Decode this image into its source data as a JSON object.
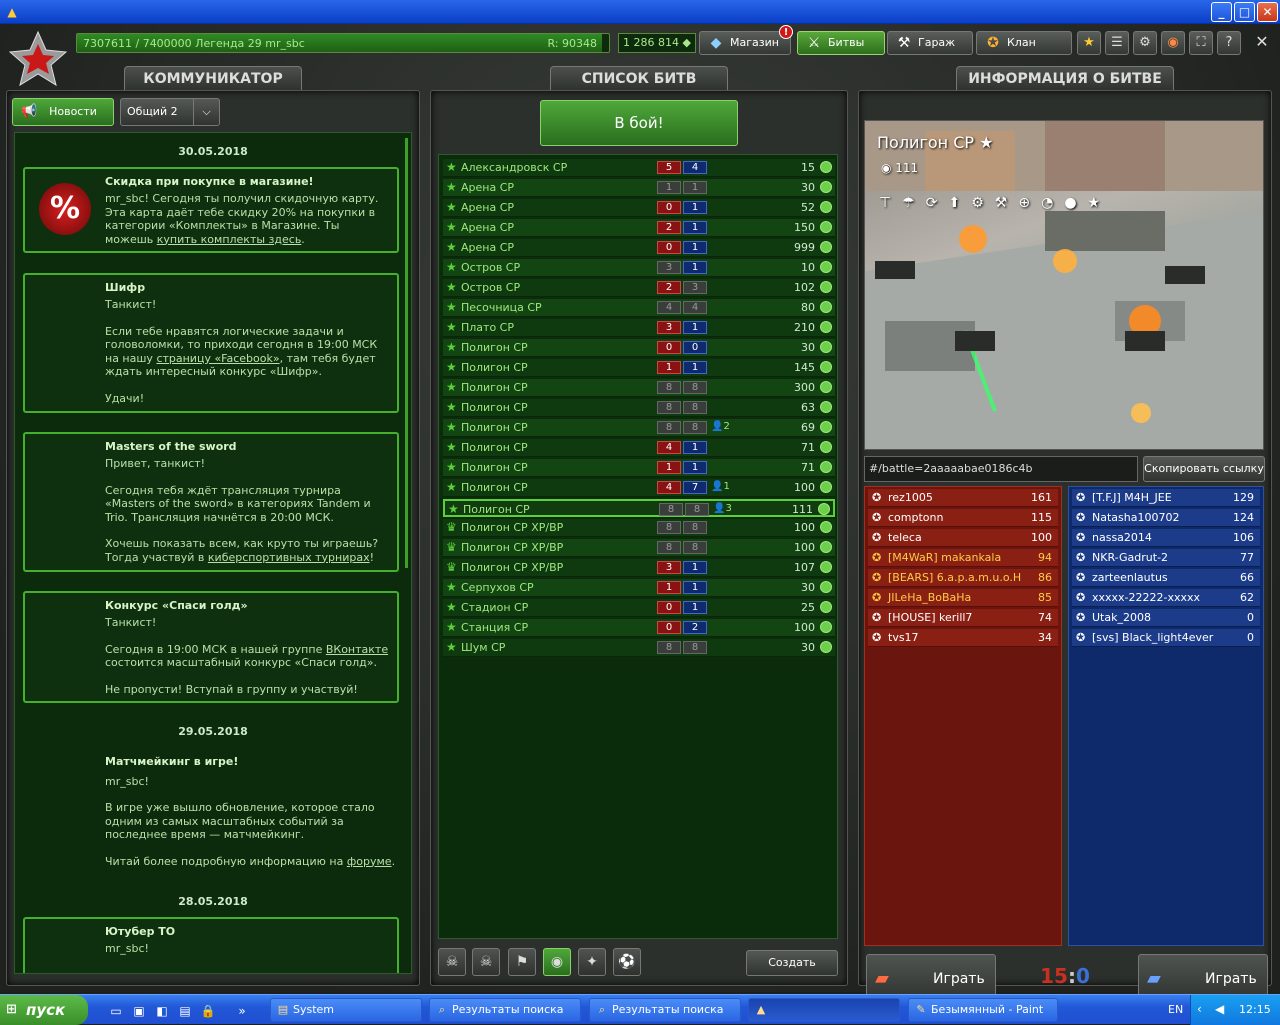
{
  "window": {
    "min": "_",
    "max": "□",
    "close": "✕"
  },
  "topbar": {
    "xp_text": "7307611 / 7400000  Легенда 29 mr_sbc",
    "rating": "R: 90348",
    "xp_progress": 0.987,
    "crystals": "1 286 814 ◆",
    "notification_badge": "!",
    "buttons": {
      "shop": "Магазин",
      "battles": "Битвы",
      "garage": "Гараж",
      "clan": "Клан"
    }
  },
  "communicator": {
    "title": "КОММУНИКАТОР",
    "news_tab": "Новости",
    "channel_select": "Общий 2",
    "days": [
      {
        "date": "30.05.2018"
      },
      {
        "date": "29.05.2018"
      },
      {
        "date": "28.05.2018"
      }
    ],
    "cards": [
      {
        "title": "Скидка при покупке в магазине!",
        "p1_a": "mr_sbc! Сегодня ты получил скидочную карту. Эта карта даёт тебе скидку 20% на покупки в категории «Комплекты» в Магазине. Ты можешь ",
        "p1_link": "купить комплекты здесь",
        "p1_b": "."
      },
      {
        "title": "Шифр",
        "p1": "Танкист!",
        "p2_a": "Если тебе нравятся логические задачи и головоломки, то приходи сегодня в 19:00 МСК на нашу ",
        "p2_link": "страницу «Facebook»",
        "p2_b": ", там тебя будет ждать интересный конкурс «Шифр».",
        "p3": "Удачи!"
      },
      {
        "title": "Masters of the sword",
        "p1": "Привет, танкист!",
        "p2": " Сегодня тебя ждёт трансляция турнира «Masters of the sword» в категориях Tandem и Trio. Трансляция начнётся в 20:00 МСК.",
        "p3_a": "Хочешь показать всем, как круто ты играешь? Тогда участвуй в ",
        "p3_link": "киберспортивных турнирах",
        "p3_b": "!"
      },
      {
        "title": "Конкурс «Спаси голд»",
        "p1": "Танкист!",
        "p2_a": "Сегодня в 19:00 МСК в нашей группе ",
        "p2_link": "ВКонтакте",
        "p2_b": " состоится масштабный конкурс «Спаси голд».",
        "p3": "Не пропусти! Вступай в группу и участвуй!"
      },
      {
        "title": "Матчмейкинг в игре!",
        "p1": "mr_sbc!",
        "p2": "В игре уже вышло обновление, которое стало одним из самых масштабных событий за последнее время — матчмейкинг.",
        "p3_a": "Читай более подробную информацию на ",
        "p3_link": "форуме",
        "p3_b": "."
      },
      {
        "title": "Ютубер ТО",
        "p1": "mr_sbc!"
      }
    ]
  },
  "battle_list": {
    "title": "СПИСОК БИТВ",
    "play_button": "В бой!",
    "create_button": "Создать",
    "rows": [
      {
        "name": "Александровск CP",
        "red": "5",
        "blue": "4",
        "spec": "",
        "count": "15",
        "icon": "star"
      },
      {
        "name": "Арена CP",
        "red": "1",
        "blue": "1",
        "spec": "",
        "count": "30",
        "icon": "star",
        "empty": true
      },
      {
        "name": "Арена CP",
        "red": "0",
        "blue": "1",
        "spec": "",
        "count": "52",
        "icon": "star"
      },
      {
        "name": "Арена CP",
        "red": "2",
        "blue": "1",
        "spec": "",
        "count": "150",
        "icon": "star"
      },
      {
        "name": "Арена CP",
        "red": "0",
        "blue": "1",
        "spec": "",
        "count": "999",
        "icon": "star"
      },
      {
        "name": "Остров CP",
        "red": "3",
        "blue": "1",
        "spec": "",
        "count": "10",
        "icon": "star",
        "redEmpty": true
      },
      {
        "name": "Остров CP",
        "red": "2",
        "blue": "3",
        "spec": "",
        "count": "102",
        "icon": "star",
        "blueEmpty": true
      },
      {
        "name": "Песочница CP",
        "red": "4",
        "blue": "4",
        "spec": "",
        "count": "80",
        "icon": "star",
        "empty": true
      },
      {
        "name": "Плато CP",
        "red": "3",
        "blue": "1",
        "spec": "",
        "count": "210",
        "icon": "star"
      },
      {
        "name": "Полигон CP",
        "red": "0",
        "blue": "0",
        "spec": "",
        "count": "30",
        "icon": "star"
      },
      {
        "name": "Полигон CP",
        "red": "1",
        "blue": "1",
        "spec": "",
        "count": "145",
        "icon": "star"
      },
      {
        "name": "Полигон CP",
        "red": "8",
        "blue": "8",
        "spec": "",
        "count": "300",
        "icon": "star",
        "empty": true
      },
      {
        "name": "Полигон CP",
        "red": "8",
        "blue": "8",
        "spec": "",
        "count": "63",
        "icon": "star",
        "empty": true
      },
      {
        "name": "Полигон CP",
        "red": "8",
        "blue": "8",
        "spec": "2",
        "count": "69",
        "icon": "star",
        "empty": true
      },
      {
        "name": "Полигон CP",
        "red": "4",
        "blue": "1",
        "spec": "",
        "count": "71",
        "icon": "star"
      },
      {
        "name": "Полигон CP",
        "red": "1",
        "blue": "1",
        "spec": "",
        "count": "71",
        "icon": "star"
      },
      {
        "name": "Полигон CP",
        "red": "4",
        "blue": "7",
        "spec": "1",
        "count": "100",
        "icon": "star"
      },
      {
        "name": "Полигон CP",
        "red": "8",
        "blue": "8",
        "spec": "3",
        "count": "111",
        "icon": "star",
        "empty": true,
        "selected": true
      },
      {
        "name": "Полигон CP XP/BP",
        "red": "8",
        "blue": "8",
        "spec": "",
        "count": "100",
        "icon": "cup",
        "empty": true
      },
      {
        "name": "Полигон CP XP/BP",
        "red": "8",
        "blue": "8",
        "spec": "",
        "count": "100",
        "icon": "cup",
        "empty": true
      },
      {
        "name": "Полигон CP XP/BP",
        "red": "3",
        "blue": "1",
        "spec": "",
        "count": "107",
        "icon": "cup"
      },
      {
        "name": "Серпухов CP",
        "red": "1",
        "blue": "1",
        "spec": "",
        "count": "30",
        "icon": "star"
      },
      {
        "name": "Стадион CP",
        "red": "0",
        "blue": "1",
        "spec": "",
        "count": "25",
        "icon": "star"
      },
      {
        "name": "Станция CP",
        "red": "0",
        "blue": "2",
        "spec": "",
        "count": "100",
        "icon": "star"
      },
      {
        "name": "Шум CP",
        "red": "8",
        "blue": "8",
        "spec": "",
        "count": "30",
        "icon": "star",
        "empty": true
      }
    ]
  },
  "battle_info": {
    "title": "ИНФОРМАЦИЯ О БИТВЕ",
    "map_name": "Полигон CP ★",
    "views": "◉ 111",
    "link": "#/battle=2aaaaabae0186c4b",
    "copy_button": "Скопировать ссылку",
    "red_team": [
      {
        "name": "rez1005",
        "score": "161"
      },
      {
        "name": "comptonn",
        "score": "115"
      },
      {
        "name": "teleca",
        "score": "100"
      },
      {
        "name": "[M4WaR] makankala",
        "score": "94",
        "yellow": true
      },
      {
        "name": "[BEARS] 6.a.p.a.m.u.o.H",
        "score": "86",
        "yellow": true
      },
      {
        "name": "JILeHa_BoBaHa",
        "score": "85",
        "yellow": true
      },
      {
        "name": "[HOUSE] kerill7",
        "score": "74"
      },
      {
        "name": "tvs17",
        "score": "34"
      }
    ],
    "blue_team": [
      {
        "name": "[T.F.J] M4H_JEE",
        "score": "129"
      },
      {
        "name": "Natasha100702",
        "score": "124"
      },
      {
        "name": "nassa2014",
        "score": "106"
      },
      {
        "name": "NKR-Gadrut-2",
        "score": "77"
      },
      {
        "name": "zarteenlautus",
        "score": "66"
      },
      {
        "name": "xxxxx-22222-xxxxx",
        "score": "62"
      },
      {
        "name": "Utak_2008",
        "score": "0"
      },
      {
        "name": "[svs] Black_light4ever",
        "score": "0"
      }
    ],
    "play_red": "Играть",
    "play_blue": "Играть",
    "score_red": "15",
    "score_sep": ":",
    "score_blue": "0"
  },
  "taskbar": {
    "start": "пуск",
    "tasks": [
      "System",
      "Результаты поиска",
      "Результаты поиска",
      "",
      "Безымянный - Paint"
    ],
    "lang": "EN",
    "time": "12:15"
  },
  "colors": {
    "accent_green": "#5cd03a",
    "red_team": "#8a2014",
    "blue_team": "#1c3c8a"
  }
}
